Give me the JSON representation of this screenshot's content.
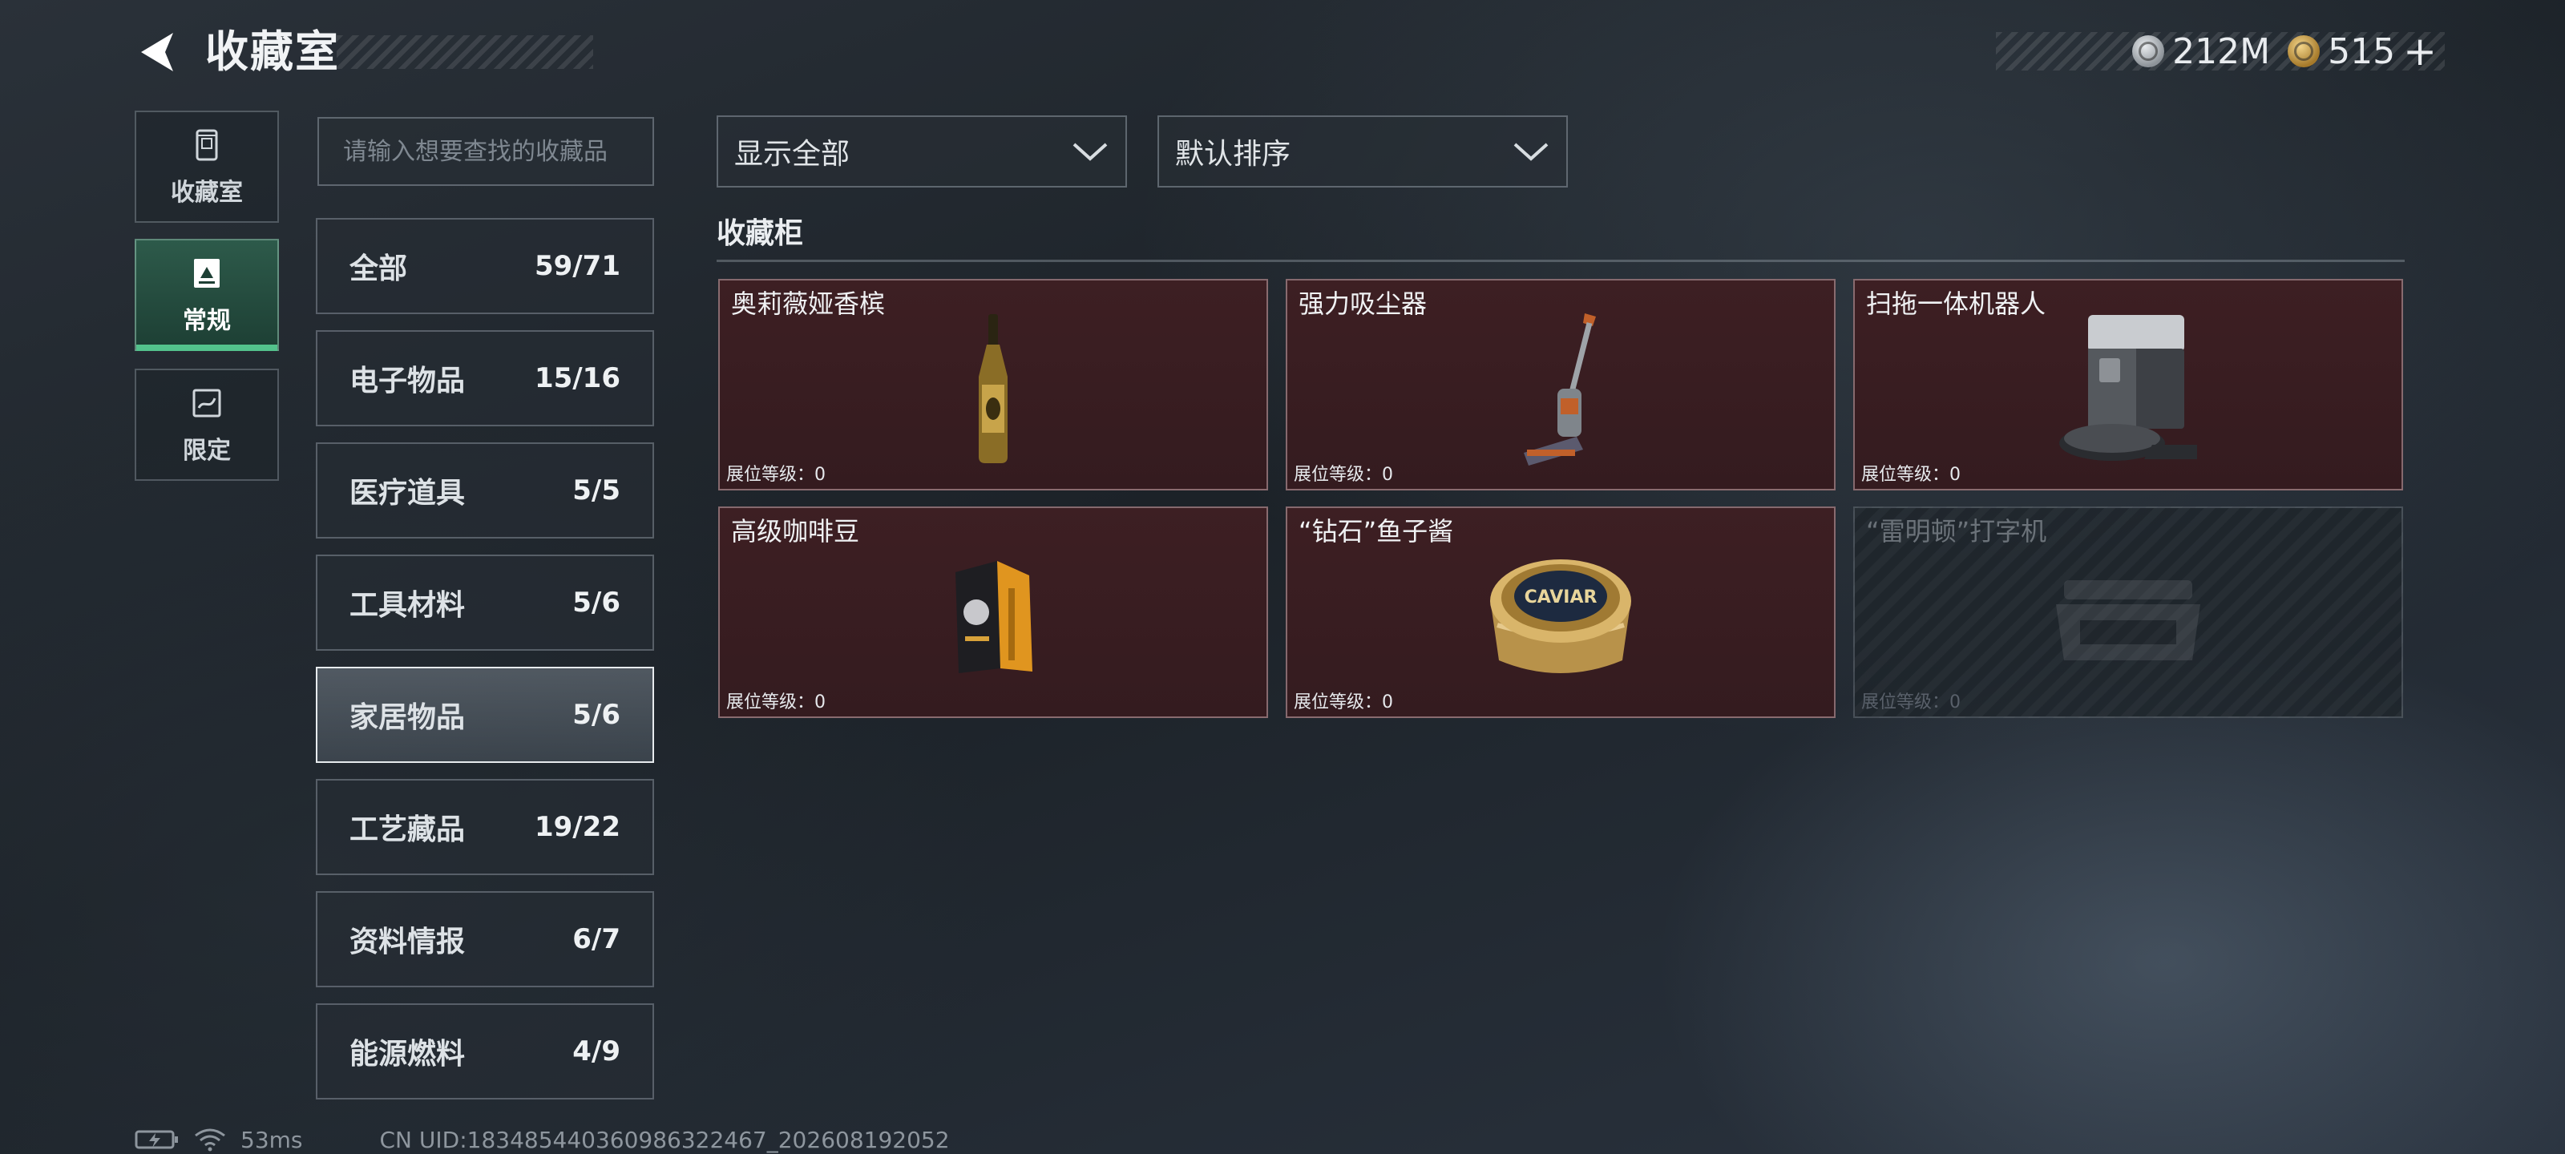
{
  "header": {
    "title": "收藏室",
    "currencies": [
      {
        "icon": "silver-coin-icon",
        "value": "212M"
      },
      {
        "icon": "gold-coin-icon",
        "value": "515"
      }
    ],
    "add_label": "+"
  },
  "left_nav": [
    {
      "icon": "collection-room-icon",
      "label": "收藏室"
    },
    {
      "icon": "regular-icon",
      "label": "常规",
      "active": true
    },
    {
      "icon": "limited-icon",
      "label": "限定"
    }
  ],
  "search": {
    "placeholder": "请输入想要查找的收藏品",
    "value": ""
  },
  "categories": [
    {
      "label": "全部",
      "count": "59/71"
    },
    {
      "label": "电子物品",
      "count": "15/16"
    },
    {
      "label": "医疗道具",
      "count": "5/5"
    },
    {
      "label": "工具材料",
      "count": "5/6"
    },
    {
      "label": "家居物品",
      "count": "5/6",
      "selected": true
    },
    {
      "label": "工艺藏品",
      "count": "19/22"
    },
    {
      "label": "资料情报",
      "count": "6/7"
    },
    {
      "label": "能源燃料",
      "count": "4/9"
    }
  ],
  "filters": {
    "show": {
      "label": "显示全部"
    },
    "sort": {
      "label": "默认排序"
    }
  },
  "section": {
    "title": "收藏柜"
  },
  "items": [
    {
      "name": "奥莉薇娅香槟",
      "level_label": "展位等级：",
      "level": "0",
      "icon": "champagne-bottle-icon",
      "owned": true
    },
    {
      "name": "强力吸尘器",
      "level_label": "展位等级：",
      "level": "0",
      "icon": "vacuum-cleaner-icon",
      "owned": true
    },
    {
      "name": "扫拖一体机器人",
      "level_label": "展位等级：",
      "level": "0",
      "icon": "robot-vacuum-station-icon",
      "owned": true
    },
    {
      "name": "高级咖啡豆",
      "level_label": "展位等级：",
      "level": "0",
      "icon": "coffee-bag-icon",
      "owned": true
    },
    {
      "name": "“钻石”鱼子酱",
      "level_label": "展位等级：",
      "level": "0",
      "icon": "caviar-tin-icon",
      "owned": true,
      "tin_text": "CAVIAR"
    },
    {
      "name": "“雷明顿”打字机",
      "level_label": "展位等级：",
      "level": "0",
      "icon": "typewriter-icon",
      "owned": false
    }
  ],
  "status": {
    "ping": "53ms",
    "uid": "CN UID:18348544036098632​2467_202608192052"
  },
  "colors": {
    "accent": "#53c28c",
    "owned_card_bg": "#3d1f23"
  }
}
